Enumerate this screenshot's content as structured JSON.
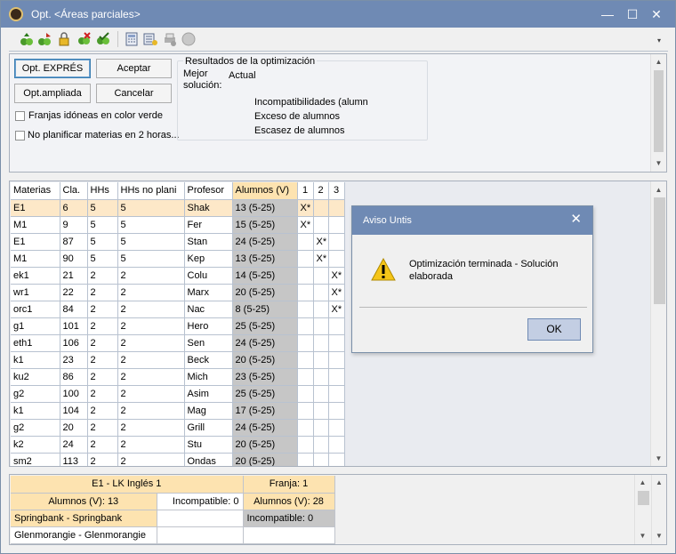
{
  "window": {
    "title": "Opt. <Áreas parciales>",
    "minimize": "—",
    "maximize": "☐",
    "close": "✕"
  },
  "toolbar": {
    "icons": [
      "optimize-icon",
      "optimize-partial-icon",
      "lock-icon",
      "delete-lessons-icon",
      "check-icon",
      "calculator-icon",
      "settings-icon",
      "print-icon",
      "stop-icon"
    ]
  },
  "buttons": {
    "opt_expres": "Opt. EXPRÉS",
    "aceptar": "Aceptar",
    "opt_ampliada": "Opt.ampliada",
    "cancelar": "Cancelar"
  },
  "options": {
    "franjas": "Franjas idóneas en color verde",
    "no_planificar": "No planificar materias en 2 horas..."
  },
  "results": {
    "group_label": "Resultados de la optimización",
    "mejor": "Mejor",
    "solucion": "solución:",
    "actual": "Actual",
    "rows": [
      "Incompatibilidades (alumn",
      "Exceso de alumnos",
      "Escasez de alumnos"
    ]
  },
  "grid": {
    "headers": [
      "Materias",
      "Cla.",
      "HHs",
      "HHs no plani",
      "Profesor",
      "Alumnos (V)",
      "1",
      "2",
      "3"
    ],
    "rows": [
      [
        "E1",
        "6",
        "5",
        "5",
        "Shak",
        "13 (5-25)",
        "X*",
        "",
        ""
      ],
      [
        "M1",
        "9",
        "5",
        "5",
        "Fer",
        "15 (5-25)",
        "X*",
        "",
        ""
      ],
      [
        "E1",
        "87",
        "5",
        "5",
        "Stan",
        "24 (5-25)",
        "",
        "X*",
        ""
      ],
      [
        "M1",
        "90",
        "5",
        "5",
        "Kep",
        "13 (5-25)",
        "",
        "X*",
        ""
      ],
      [
        "ek1",
        "21",
        "2",
        "2",
        "Colu",
        "14 (5-25)",
        "",
        "",
        "X*"
      ],
      [
        "wr1",
        "22",
        "2",
        "2",
        "Marx",
        "20 (5-25)",
        "",
        "",
        "X*"
      ],
      [
        "orc1",
        "84",
        "2",
        "2",
        "Nac",
        "8 (5-25)",
        "",
        "",
        "X*"
      ],
      [
        "g1",
        "101",
        "2",
        "2",
        "Hero",
        "25 (5-25)",
        "",
        "",
        ""
      ],
      [
        "eth1",
        "106",
        "2",
        "2",
        "Sen",
        "24 (5-25)",
        "",
        "",
        ""
      ],
      [
        "k1",
        "23",
        "2",
        "2",
        "Beck",
        "20 (5-25)",
        "",
        "",
        ""
      ],
      [
        "ku2",
        "86",
        "2",
        "2",
        "Mich",
        "23 (5-25)",
        "",
        "",
        ""
      ],
      [
        "g2",
        "100",
        "2",
        "2",
        "Asim",
        "25 (5-25)",
        "",
        "",
        ""
      ],
      [
        "k1",
        "104",
        "2",
        "2",
        "Mag",
        "17 (5-25)",
        "",
        "",
        ""
      ],
      [
        "g2",
        "20",
        "2",
        "2",
        "Grill",
        "24 (5-25)",
        "",
        "",
        ""
      ],
      [
        "k2",
        "24",
        "2",
        "2",
        "Stu",
        "20 (5-25)",
        "",
        "",
        ""
      ],
      [
        "sm2",
        "113",
        "2",
        "2",
        "Ondas",
        "20 (5-25)",
        "",
        "",
        ""
      ]
    ]
  },
  "dialog": {
    "title": "Aviso Untis",
    "close": "✕",
    "message": "Optimización terminada - Solución elaborada",
    "ok": "OK"
  },
  "bottom": {
    "header_left": "E1 - LK Inglés 1",
    "header_right": "Franja: 1",
    "alumnos_left": "Alumnos (V): 13",
    "incomp_left": "Incompatible: 0",
    "alumnos_right": "Alumnos (V): 28",
    "row1": "Springbank - Springbank",
    "incomp_right": "Incompatible: 0",
    "row2": "Glenmorangie - Glenmorangie"
  }
}
